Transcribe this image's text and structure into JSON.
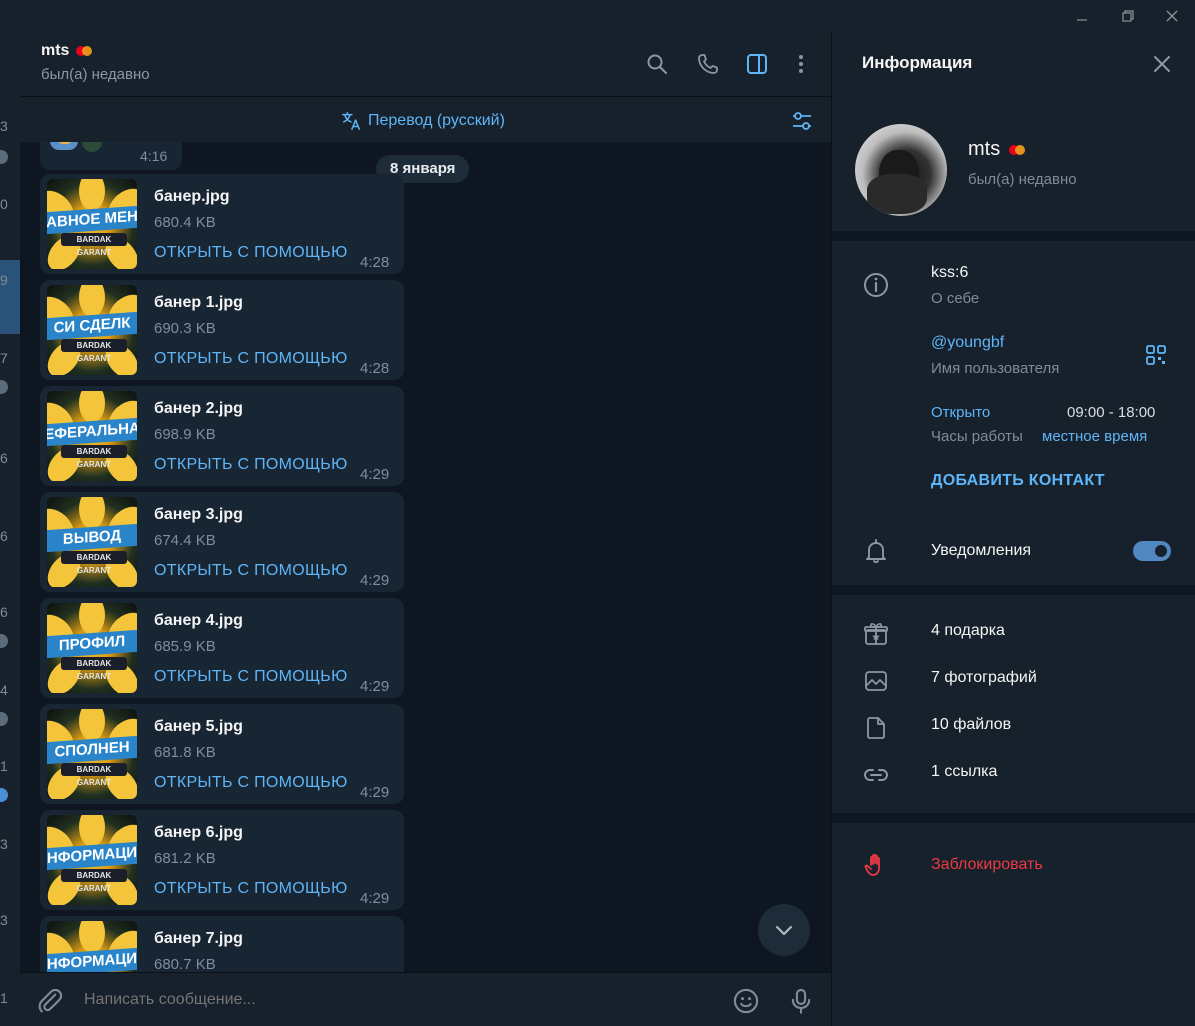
{
  "window": {
    "controls": [
      "minimize",
      "restore",
      "close"
    ]
  },
  "left_strip": {
    "numbers": [
      "3",
      "0",
      "9",
      "7",
      "6",
      "6",
      "6",
      "4",
      "1",
      "3",
      "3",
      "1"
    ]
  },
  "chat_header": {
    "name": "mts",
    "status": "был(а) недавно"
  },
  "translate_bar": {
    "label": "Перевод (русский)"
  },
  "messages": {
    "prev_time": "4:16",
    "date": "8 января",
    "open_with_label": "ОТКРЫТЬ С ПОМОЩЬЮ",
    "files": [
      {
        "name": "банер.jpg",
        "size": "680.4 KB",
        "time": "4:28",
        "thumb_text": "АВНОЕ МЕН",
        "thumb_color": "#2a84c9"
      },
      {
        "name": "банер 1.jpg",
        "size": "690.3 KB",
        "time": "4:28",
        "thumb_text": "СИ СДЕЛК",
        "thumb_color": "#2a84c9"
      },
      {
        "name": "банер 2.jpg",
        "size": "698.9 KB",
        "time": "4:29",
        "thumb_text": "ЕФЕРАЛЬНА",
        "thumb_color": "#2a84c9"
      },
      {
        "name": "банер 3.jpg",
        "size": "674.4 KB",
        "time": "4:29",
        "thumb_text": "ВЫВОД",
        "thumb_color": "#2a84c9"
      },
      {
        "name": "банер 4.jpg",
        "size": "685.9 KB",
        "time": "4:29",
        "thumb_text": "ПРОФИЛ",
        "thumb_color": "#2a84c9"
      },
      {
        "name": "банер 5.jpg",
        "size": "681.8 KB",
        "time": "4:29",
        "thumb_text": "СПОЛНЕН",
        "thumb_color": "#2a84c9"
      },
      {
        "name": "банер 6.jpg",
        "size": "681.2 KB",
        "time": "4:29",
        "thumb_text": "НФОРМАЦИ",
        "thumb_color": "#2a84c9"
      },
      {
        "name": "банер 7.jpg",
        "size": "680.7 KB",
        "time": "",
        "thumb_text": "НФОРМАЦИ",
        "thumb_color": "#2a84c9"
      }
    ],
    "thumb_brand": "BARDAK GARANT"
  },
  "composer": {
    "placeholder": "Написать сообщение..."
  },
  "info_panel": {
    "title": "Информация",
    "name": "mts",
    "status": "был(а) недавно",
    "bio": "kss:6",
    "bio_label": "О себе",
    "username": "@youngbf",
    "username_label": "Имя пользователя",
    "hours_status": "Открыто",
    "hours_range": "09:00 - 18:00",
    "hours_label": "Часы работы",
    "hours_local": "местное время",
    "add_contact": "ДОБАВИТЬ КОНТАКТ",
    "notifications": "Уведомления",
    "notifications_on": true,
    "media": [
      {
        "label": "4 подарка",
        "icon": "gift-icon"
      },
      {
        "label": "7 фотографий",
        "icon": "photo-icon"
      },
      {
        "label": "10 файлов",
        "icon": "file-icon"
      },
      {
        "label": "1 ссылка",
        "icon": "link-icon"
      }
    ],
    "block": "Заблокировать"
  },
  "colors": {
    "accent": "#5eb5f7",
    "danger": "#ec3942",
    "panel": "#17212b",
    "background": "#0e1621",
    "bubble": "#182533"
  }
}
